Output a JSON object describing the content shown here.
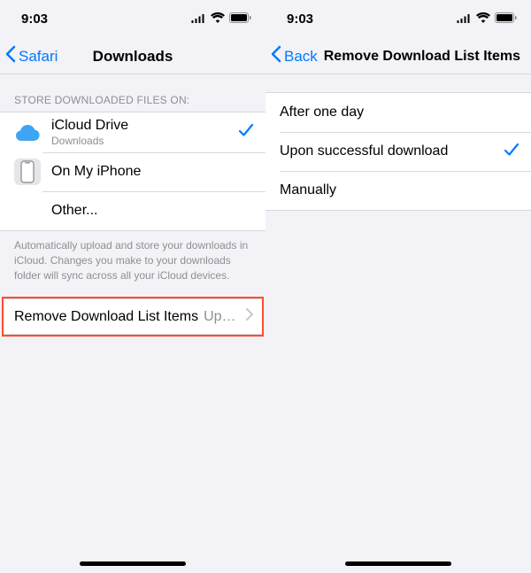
{
  "status": {
    "time": "9:03"
  },
  "screen1": {
    "back_label": "Safari",
    "title": "Downloads",
    "section_header": "Store Downloaded Files On:",
    "options": [
      {
        "title": "iCloud Drive",
        "subtitle": "Downloads",
        "selected": true
      },
      {
        "title": "On My iPhone",
        "selected": false
      },
      {
        "title": "Other...",
        "selected": false
      }
    ],
    "footer": "Automatically upload and store your downloads in iCloud. Changes you make to your downloads folder will sync across all your iCloud devices.",
    "link": {
      "label": "Remove Download List Items",
      "value": "Upon succes…"
    }
  },
  "screen2": {
    "back_label": "Back",
    "title": "Remove Download List Items",
    "options": [
      {
        "title": "After one day",
        "selected": false
      },
      {
        "title": "Upon successful download",
        "selected": true
      },
      {
        "title": "Manually",
        "selected": false
      }
    ]
  }
}
